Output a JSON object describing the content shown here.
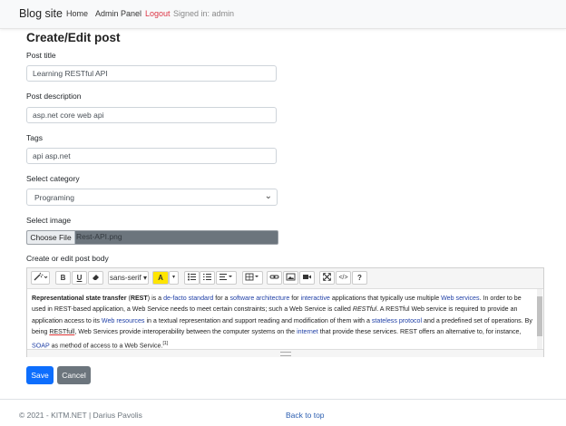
{
  "navbar": {
    "brand": "Blog site",
    "links": [
      "Home",
      "Admin Panel",
      "Logout"
    ],
    "signed_in": "Signed in: admin",
    "logout_color": "#dc3545"
  },
  "page_title": "Create/Edit post",
  "form": {
    "title_label": "Post title",
    "title_value": "Learning RESTful API",
    "description_label": "Post description",
    "description_value": "asp.net core web api",
    "tags_label": "Tags",
    "tags_value": "api asp.net",
    "category_label": "Select category",
    "category_value": "Programing",
    "image_label": "Select image",
    "choose_file": "Choose File",
    "file_name": "Rest-API.png",
    "body_label": "Create or edit post body"
  },
  "editor": {
    "font_name": "sans-serif",
    "toolbar_icons": [
      "magic-wand-icon",
      "bold-icon",
      "underline-icon",
      "eraser-icon",
      "font-name-dropdown",
      "font-color-icon",
      "color-dropdown-icon",
      "unordered-list-icon",
      "ordered-list-icon",
      "paragraph-icon",
      "table-icon",
      "link-icon",
      "picture-icon",
      "video-icon",
      "fullscreen-icon",
      "code-view-icon",
      "help-icon"
    ],
    "bold_glyph": "B",
    "underline_glyph": "U",
    "help_glyph": "?",
    "color_glyph": "A",
    "body": {
      "t1": "Representational state transfer",
      "t2": " (",
      "t3": "REST",
      "t4": ") is a ",
      "l1": "de-facto standard",
      "t5": " for a ",
      "l2": "software architecture",
      "t6": " for ",
      "l3": "interactive",
      "t7": " applications that typically use multiple ",
      "l4": "Web services",
      "t8": ". In order to be used in REST-based application, a Web Service needs to meet certain constraints; such a Web Service is called ",
      "i1": "RESTful",
      "t9": ". A RESTful Web service is required to provide an application access to its ",
      "l5": "Web resources",
      "t10": " in a textual representation and support reading and modification of them with a ",
      "l6": "stateless protocol",
      "t11": " and a predefined set of operations. By being ",
      "u1": "RESTfull",
      "t12": ", Web Services provide interoperability between the computer systems on the ",
      "l7": "internet",
      "t13": " that provide these services. REST offers an alternative to, for instance, ",
      "l8": "SOAP",
      "t14": " as method of access to a Web Service.",
      "sup": "[1]"
    }
  },
  "actions": {
    "save": "Save",
    "cancel": "Cancel"
  },
  "footer": {
    "copyright": "© 2021 - KITM.NET | Darius Pavolis",
    "back_to_top": "Back to top"
  },
  "colors": {
    "primary": "#0d6efd",
    "secondary": "#6c757d",
    "link": "#1f3fa6"
  }
}
